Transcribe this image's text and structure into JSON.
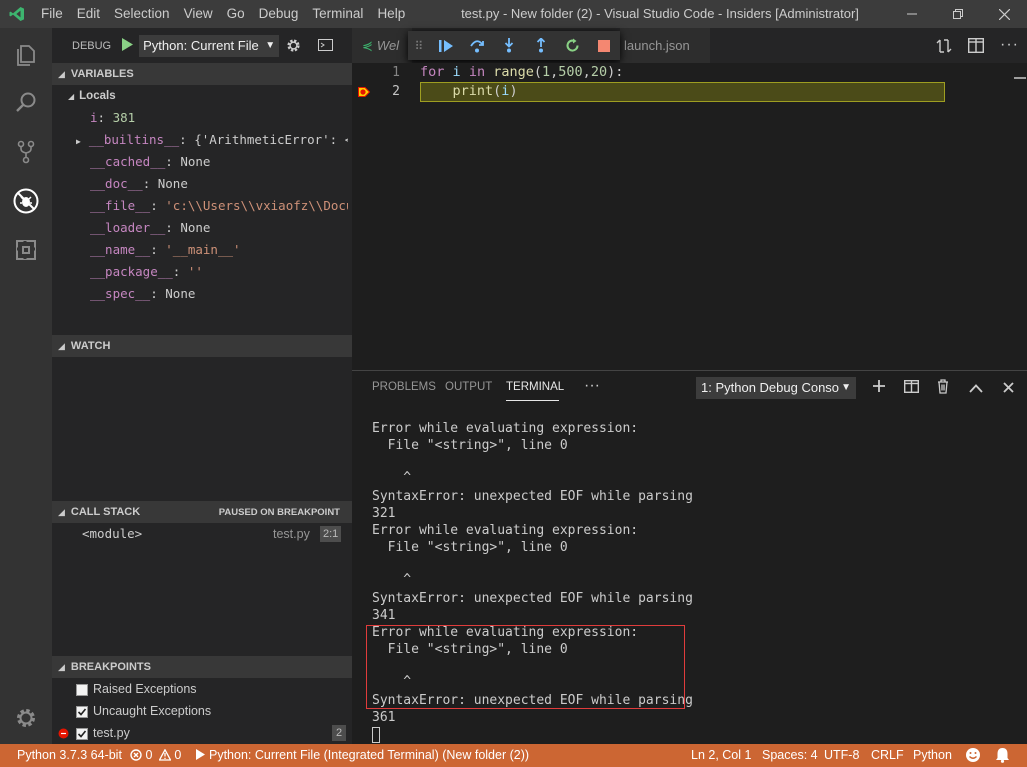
{
  "window": {
    "menu": [
      "File",
      "Edit",
      "Selection",
      "View",
      "Go",
      "Debug",
      "Terminal",
      "Help"
    ],
    "title": "test.py - New folder (2) - Visual Studio Code - Insiders [Administrator]"
  },
  "debug": {
    "label": "DEBUG",
    "config": "Python: Current File"
  },
  "variables": {
    "header": "VARIABLES",
    "scope": "Locals",
    "items": [
      {
        "name": "i",
        "value": "381"
      },
      {
        "name": "__builtins__",
        "value": "{'ArithmeticError': <…"
      },
      {
        "name": "__cached__",
        "value": "None"
      },
      {
        "name": "__doc__",
        "value": "None"
      },
      {
        "name": "__file__",
        "value": "'c:\\\\Users\\\\vxiaofz\\\\Docu…"
      },
      {
        "name": "__loader__",
        "value": "None"
      },
      {
        "name": "__name__",
        "value": "'__main__'"
      },
      {
        "name": "__package__",
        "value": "''"
      },
      {
        "name": "__spec__",
        "value": "None"
      }
    ]
  },
  "watch": {
    "header": "WATCH"
  },
  "callstack": {
    "header": "CALL STACK",
    "status": "PAUSED ON BREAKPOINT",
    "frame": "<module>",
    "file": "test.py",
    "pos": "2:1"
  },
  "breakpoints": {
    "header": "BREAKPOINTS",
    "items": [
      {
        "label": "Raised Exceptions",
        "checked": false
      },
      {
        "label": "Uncaught Exceptions",
        "checked": true
      },
      {
        "label": "test.py",
        "checked": true,
        "count": "2"
      }
    ]
  },
  "tabs": {
    "first": "Wel",
    "second": "launch.json"
  },
  "editor": {
    "lines": [
      {
        "no": "1",
        "code": "for i in range(1,500,20):"
      },
      {
        "no": "2",
        "code": "    print(i)"
      }
    ]
  },
  "panel": {
    "tabs": [
      "PROBLEMS",
      "OUTPUT",
      "TERMINAL"
    ],
    "more": "···",
    "terminal_select": "1: Python Debug Conso",
    "lines": [
      "Error while evaluating expression:",
      "  File \"<string>\", line 0",
      "",
      "    ^",
      "SyntaxError: unexpected EOF while parsing",
      "321",
      "Error while evaluating expression:",
      "  File \"<string>\", line 0",
      "",
      "    ^",
      "SyntaxError: unexpected EOF while parsing",
      "341",
      "Error while evaluating expression:",
      "  File \"<string>\", line 0",
      "",
      "    ^",
      "SyntaxError: unexpected EOF while parsing",
      "361"
    ]
  },
  "status": {
    "python": "Python 3.7.3 64-bit",
    "errors": "0",
    "warnings": "0",
    "run": "Python: Current File (Integrated Terminal) (New folder (2))",
    "position": "Ln 2, Col 1",
    "spaces": "Spaces: 4",
    "encoding": "UTF-8",
    "eol": "CRLF",
    "language": "Python"
  },
  "colors": {
    "statusbar": "#cc6633",
    "highlight": "#4b4b18",
    "highlight_border": "#9e9e21",
    "highlight_box": "#e03c3c"
  }
}
